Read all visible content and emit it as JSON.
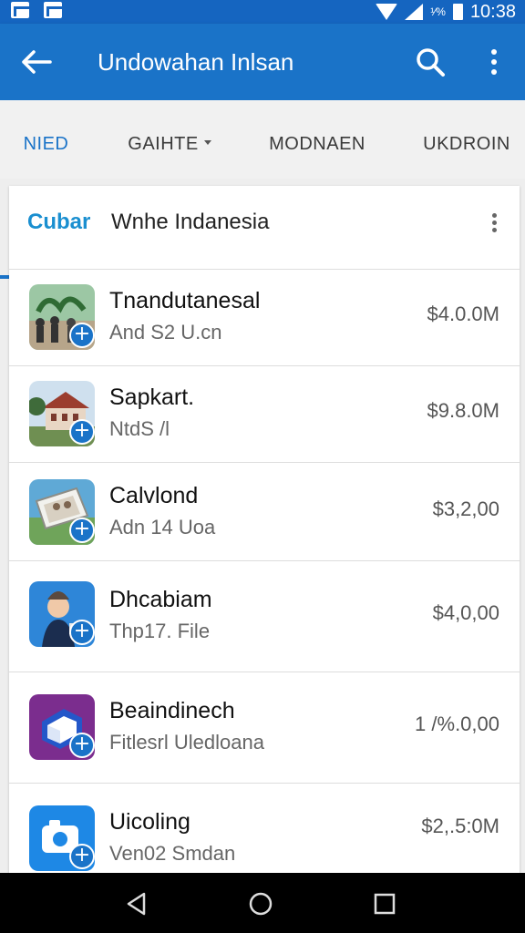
{
  "status_bar": {
    "battery_pct": "¹⁄%",
    "time": "10:38"
  },
  "app_bar": {
    "title": "Undowahan Inlsan"
  },
  "tabs": [
    {
      "label": "NIED"
    },
    {
      "label": "GAIHTE"
    },
    {
      "label": "MODNAEN"
    },
    {
      "label": "UKDROIN"
    }
  ],
  "card": {
    "brand": "Cubar",
    "heading": "Wnhe Indanesia"
  },
  "apps": [
    {
      "name": "Tnandutanesal",
      "sub": "And S2 U.cn",
      "price": "$4.0.0M",
      "icon": "crowd-photo-icon"
    },
    {
      "name": "Sapkart.",
      "sub": "NtdS /l",
      "price": "$9.8.0M",
      "icon": "house-photo-icon"
    },
    {
      "name": "Calvlond",
      "sub": "Adn 14 Uoa",
      "price": "$3,2,00",
      "icon": "picture-frame-icon"
    },
    {
      "name": "Dhcabiam",
      "sub": "Thp17. File",
      "price": "$4,0,00",
      "icon": "person-photo-icon"
    },
    {
      "name": "Beaindinech",
      "sub": "Fitlesrl Uledloana",
      "price": "1 /%.0,00",
      "icon": "purple-cube-icon"
    },
    {
      "name": "Uicoling",
      "sub": "Ven02 Smdan",
      "price": "$2,.5:0M",
      "icon": "camera-icon"
    }
  ],
  "colors": {
    "primary": "#1a73c8",
    "status_bar": "#1565c0",
    "accent": "#1a8fd0"
  }
}
